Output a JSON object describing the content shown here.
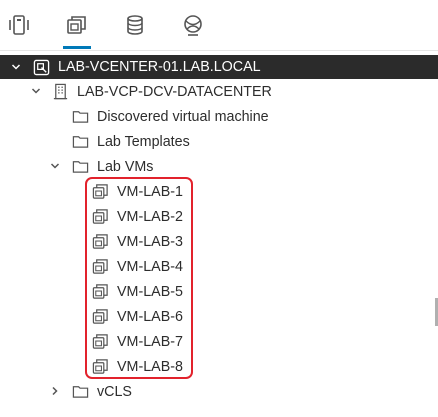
{
  "tabs": [
    {
      "id": "hosts",
      "icon": "hosts-clusters-icon"
    },
    {
      "id": "vms",
      "icon": "vms-templates-icon",
      "active": true
    },
    {
      "id": "storage",
      "icon": "datastore-icon"
    },
    {
      "id": "network",
      "icon": "network-icon"
    }
  ],
  "tree": {
    "vcenter": {
      "label": "LAB-VCENTER-01.LAB.LOCAL",
      "icon": "vcenter-icon"
    },
    "datacenter": {
      "label": "LAB-VCP-DCV-DATACENTER",
      "icon": "datacenter-icon"
    },
    "folders": [
      {
        "label": "Discovered virtual machine",
        "icon": "folder-icon"
      },
      {
        "label": "Lab Templates",
        "icon": "folder-icon"
      },
      {
        "label": "Lab VMs",
        "icon": "folder-icon",
        "expanded": true
      }
    ],
    "vms": [
      {
        "label": "VM-LAB-1",
        "icon": "vm-icon"
      },
      {
        "label": "VM-LAB-2",
        "icon": "vm-icon"
      },
      {
        "label": "VM-LAB-3",
        "icon": "vm-icon"
      },
      {
        "label": "VM-LAB-4",
        "icon": "vm-icon"
      },
      {
        "label": "VM-LAB-5",
        "icon": "vm-icon"
      },
      {
        "label": "VM-LAB-6",
        "icon": "vm-icon"
      },
      {
        "label": "VM-LAB-7",
        "icon": "vm-icon"
      },
      {
        "label": "VM-LAB-8",
        "icon": "vm-icon"
      }
    ],
    "vcls": {
      "label": "vCLS",
      "icon": "folder-icon",
      "expanded": false
    }
  },
  "colors": {
    "accent": "#0079b8",
    "selected_bg": "#2b2b2b",
    "highlight": "#e2222c"
  }
}
